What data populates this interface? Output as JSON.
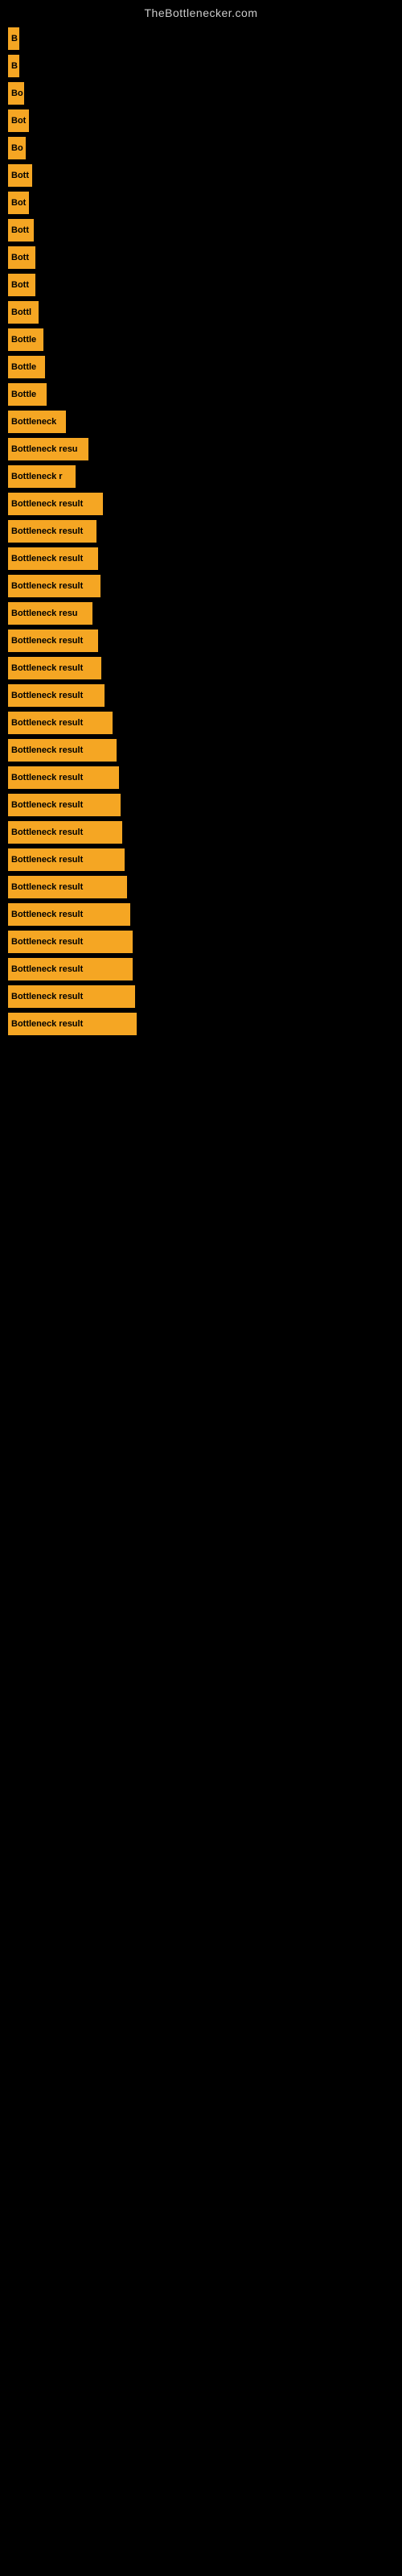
{
  "site": {
    "title": "TheBottlenecker.com"
  },
  "bars": [
    {
      "label": "B",
      "width": 14
    },
    {
      "label": "B",
      "width": 14
    },
    {
      "label": "Bo",
      "width": 20
    },
    {
      "label": "Bot",
      "width": 26
    },
    {
      "label": "Bo",
      "width": 22
    },
    {
      "label": "Bott",
      "width": 30
    },
    {
      "label": "Bot",
      "width": 26
    },
    {
      "label": "Bott",
      "width": 32
    },
    {
      "label": "Bott",
      "width": 34
    },
    {
      "label": "Bott",
      "width": 34
    },
    {
      "label": "Bottl",
      "width": 38
    },
    {
      "label": "Bottle",
      "width": 44
    },
    {
      "label": "Bottle",
      "width": 46
    },
    {
      "label": "Bottle",
      "width": 48
    },
    {
      "label": "Bottleneck",
      "width": 72
    },
    {
      "label": "Bottleneck resu",
      "width": 100
    },
    {
      "label": "Bottleneck r",
      "width": 84
    },
    {
      "label": "Bottleneck result",
      "width": 118
    },
    {
      "label": "Bottleneck result",
      "width": 110
    },
    {
      "label": "Bottleneck result",
      "width": 112
    },
    {
      "label": "Bottleneck result",
      "width": 115
    },
    {
      "label": "Bottleneck resu",
      "width": 105
    },
    {
      "label": "Bottleneck result",
      "width": 112
    },
    {
      "label": "Bottleneck result",
      "width": 116
    },
    {
      "label": "Bottleneck result",
      "width": 120
    },
    {
      "label": "Bottleneck result",
      "width": 130
    },
    {
      "label": "Bottleneck result",
      "width": 135
    },
    {
      "label": "Bottleneck result",
      "width": 138
    },
    {
      "label": "Bottleneck result",
      "width": 140
    },
    {
      "label": "Bottleneck result",
      "width": 142
    },
    {
      "label": "Bottleneck result",
      "width": 145
    },
    {
      "label": "Bottleneck result",
      "width": 148
    },
    {
      "label": "Bottleneck result",
      "width": 152
    },
    {
      "label": "Bottleneck result",
      "width": 155
    },
    {
      "label": "Bottleneck result",
      "width": 155
    },
    {
      "label": "Bottleneck result",
      "width": 158
    },
    {
      "label": "Bottleneck result",
      "width": 160
    }
  ]
}
